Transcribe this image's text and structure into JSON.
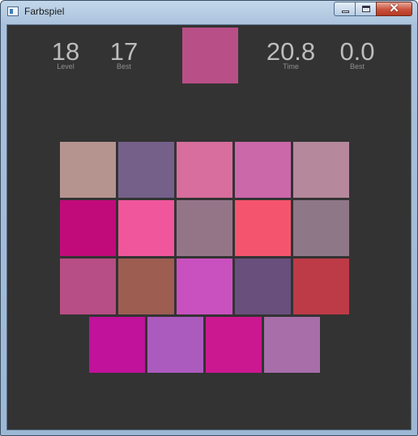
{
  "window": {
    "title": "Farbspiel",
    "controls": {
      "close_glyph": "✕"
    }
  },
  "stats": {
    "level": {
      "value": "18",
      "label": "Level"
    },
    "best_level": {
      "value": "17",
      "label": "Best"
    },
    "time": {
      "value": "20.8",
      "label": "Time"
    },
    "best_time": {
      "value": "0.0",
      "label": "Best"
    }
  },
  "target_color": "#b84f87",
  "colors": {
    "background": "#333333",
    "stat_text": "#bdbdbd",
    "stat_label": "#8f8f8f"
  },
  "grid": {
    "rows": [
      [
        "#b59490",
        "#75608a",
        "#d76e9d",
        "#cb68a9",
        "#b5889c"
      ],
      [
        "#c20b7a",
        "#f0569b",
        "#947588",
        "#f5546e",
        "#8e7787"
      ],
      [
        "#b74e85",
        "#9d5d51",
        "#c951bf",
        "#684f7c",
        "#bd3b46"
      ],
      [
        "#c0129a",
        "#ab5bbd",
        "#cc1890",
        "#a76ea9"
      ]
    ]
  }
}
